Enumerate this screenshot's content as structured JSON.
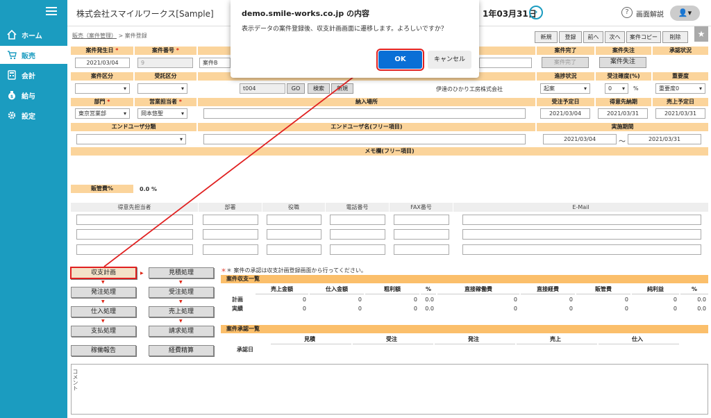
{
  "sidebar": {
    "items": [
      {
        "label": "ホーム",
        "icon": "home-icon"
      },
      {
        "label": "販売",
        "icon": "cart-icon"
      },
      {
        "label": "会計",
        "icon": "calculator-icon"
      },
      {
        "label": "給与",
        "icon": "money-bag-icon"
      },
      {
        "label": "設定",
        "icon": "gear-icon"
      }
    ]
  },
  "header": {
    "title": "株式会社スマイルワークス[Sample]",
    "date": "1年03月31日",
    "help": "画面解説"
  },
  "breadcrumb": {
    "parent": "販売（案件管理）",
    "separator": ">",
    "current": "案件登録"
  },
  "toolbar": {
    "buttons": [
      "新規",
      "登録",
      "前へ",
      "次へ",
      "案件コピー",
      "削除"
    ]
  },
  "form": {
    "labels": {
      "start_date": "案件発生日",
      "case_no": "案件番号",
      "completed": "案件完了",
      "lost": "案件失注",
      "approval": "承認状況",
      "category": "案件区分",
      "contract": "受託区分",
      "progress": "進捗状況",
      "probability": "受注確度(%)",
      "importance": "重要度",
      "dept": "部門",
      "sales": "営業担当者",
      "delivery": "納入場所",
      "order_date": "受注予定日",
      "due_date": "得意先納期",
      "sales_date": "売上予定日",
      "enduser_cat": "エンドユーザ分類",
      "enduser_name": "エンドユーザ名(フリー項目)",
      "period": "実施期間",
      "memo": "メモ欄(フリー項目)",
      "margin": "販管費%"
    },
    "values": {
      "start_date": "2021/03/04",
      "case_no": "9",
      "case_name": "案件B",
      "client_code": "t004",
      "client_name": "伊達のひかり工房株式会社",
      "progress": "起案",
      "probability": "0",
      "probability_unit": "%",
      "importance": "重要度0",
      "dept": "東京営業部",
      "sales": "岡本悠聖",
      "order_date": "2021/03/04",
      "due_date": "2021/03/31",
      "sales_date": "2021/03/31",
      "period_from": "2021/03/04",
      "period_sep": "〜",
      "period_to": "2021/03/31",
      "margin": "0.0 %"
    },
    "buttons": {
      "complete": "案件完了",
      "lost": "案件失注",
      "go": "GO",
      "search": "検索",
      "new": "新規"
    }
  },
  "contacts": {
    "headers": [
      "得意先担当者",
      "部署",
      "役職",
      "電話番号",
      "FAX番号",
      "E-Mail"
    ]
  },
  "process": {
    "left": [
      "収支計画",
      "発注処理",
      "仕入処理",
      "支払処理",
      "稼働報告"
    ],
    "right": [
      "見積処理",
      "受注処理",
      "売上処理",
      "請求処理",
      "経費精算"
    ]
  },
  "summary": {
    "note": "＊ 案件の承認は収支計画登録画面から行ってください。",
    "title": "案件収支一覧",
    "headers": [
      "売上金額",
      "仕入金額",
      "粗利額",
      "%",
      "直接稼働費",
      "直接経費",
      "販管費",
      "純利益",
      "%"
    ],
    "rows": [
      {
        "label": "計画",
        "values": [
          "0",
          "0",
          "0",
          "0.0",
          "0",
          "0",
          "0",
          "0",
          "0.0"
        ]
      },
      {
        "label": "実績",
        "values": [
          "0",
          "0",
          "0",
          "0.0",
          "0",
          "0",
          "0",
          "0",
          "0.0"
        ]
      }
    ]
  },
  "approval": {
    "title": "案件承認一覧",
    "headers": [
      "見積",
      "受注",
      "発注",
      "売上",
      "仕入"
    ],
    "row_label": "承認日"
  },
  "comment": {
    "label": "コメント"
  },
  "dialog": {
    "title": "demo.smile-works.co.jp の内容",
    "message": "表示データの案件登録後、収支計画画面に遷移します。よろしいですか？",
    "ok": "OK",
    "cancel": "キャンセル"
  },
  "colors": {
    "sidebar": "#1b9cc0",
    "label_bg": "#fbd49b",
    "section_bg": "#fbbf6b",
    "ok_button": "#0a6fd6",
    "highlight": "#e02020"
  }
}
